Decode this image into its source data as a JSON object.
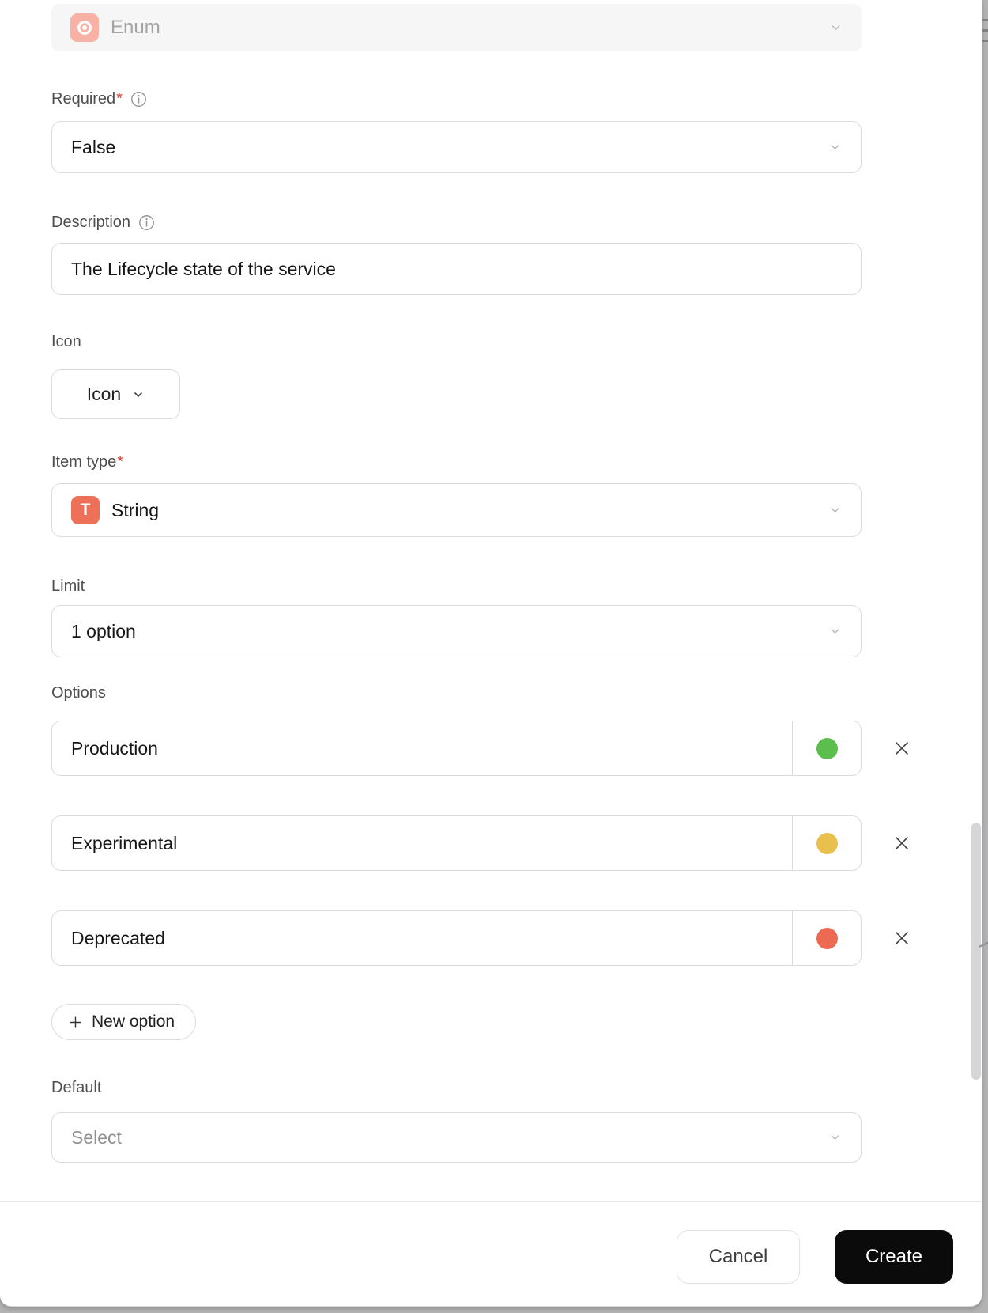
{
  "dialog": {
    "type_field": {
      "value": "Enum"
    },
    "required": {
      "label": "Required",
      "asterisk": "*",
      "value": "False"
    },
    "description": {
      "label": "Description",
      "value": "The Lifecycle state of the service"
    },
    "icon_field": {
      "label": "Icon",
      "button_label": "Icon"
    },
    "item_type": {
      "label": "Item type",
      "asterisk": "*",
      "badge": "T",
      "value": "String"
    },
    "limit": {
      "label": "Limit",
      "value": "1 option"
    },
    "options": {
      "label": "Options",
      "items": [
        {
          "name": "Production",
          "color": "#5cbe4d"
        },
        {
          "name": "Experimental",
          "color": "#e9c04d"
        },
        {
          "name": "Deprecated",
          "color": "#ec6a52"
        }
      ]
    },
    "new_option_label": "New option",
    "default_field": {
      "label": "Default",
      "placeholder": "Select"
    },
    "footer": {
      "cancel_label": "Cancel",
      "create_label": "Create"
    }
  },
  "colors": {
    "enum_badge_bg": "#f7b2a5",
    "string_badge_bg": "#ec7158",
    "create_button_bg": "#0b0b0b",
    "page_background": "#b3b3b3",
    "option_green": "#5cbe4d",
    "option_yellow": "#e9c04d",
    "option_red": "#ec6a52"
  }
}
